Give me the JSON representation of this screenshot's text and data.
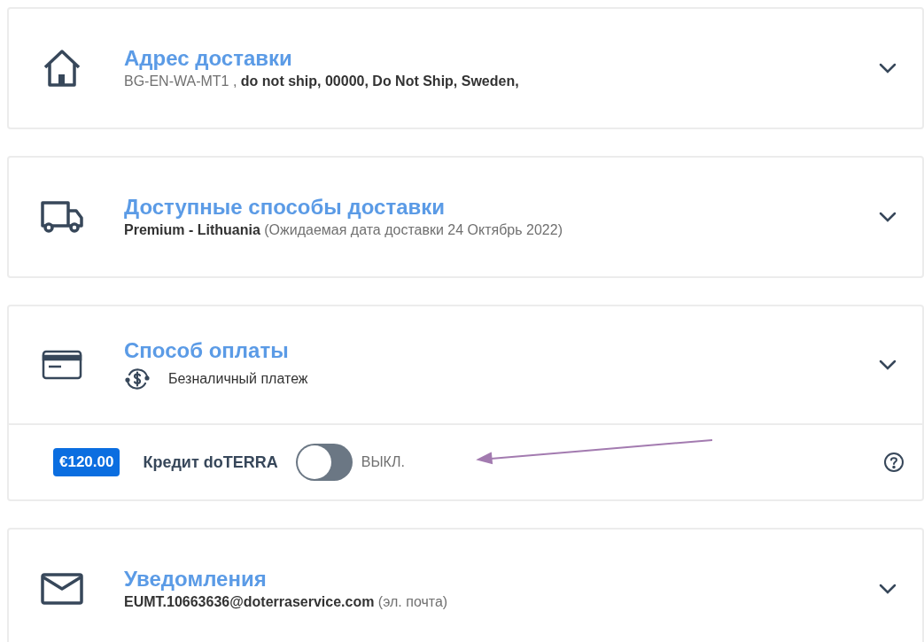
{
  "sections": [
    {
      "kind": "home",
      "title": "Адрес доставки",
      "subtitle": "BG-EN-WA-MT1 , **do not ship, 00000, Do Not Ship, Sweden,**",
      "expanded": false
    },
    {
      "kind": "truck",
      "title": "Доступные способы доставки",
      "subtitle": "**Premium - Lithuania** (Ожидаемая дата доставки 24 Октябрь 2022)",
      "expanded": false
    },
    {
      "kind": "card",
      "title": "Способ оплаты",
      "method": "Безналичный платеж",
      "expanded": false,
      "credit": {
        "amount": "€120.00",
        "label": "Кредит doTERRA",
        "on": false,
        "state": "ВЫКЛ."
      }
    },
    {
      "kind": "mail",
      "title": "Уведомления",
      "subtitle": "**EUMT.10663636@doterraservice.com** (эл. почта)",
      "expanded": false
    }
  ]
}
